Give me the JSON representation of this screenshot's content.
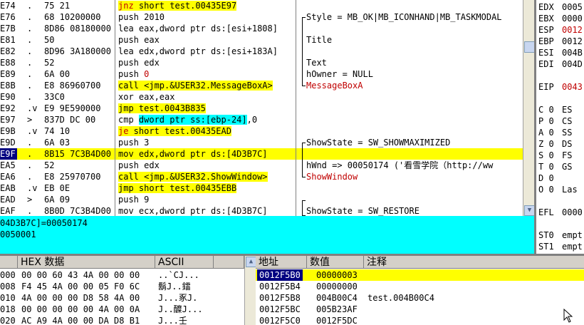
{
  "disasm": {
    "rows": [
      {
        "addr": "E74",
        "mark": ".",
        "op": "75 21",
        "instr": [
          {
            "t": "jnz",
            "c": "red hl-y"
          },
          {
            "t": " short test.00435E97",
            "c": "hl-y"
          }
        ],
        "comment": ""
      },
      {
        "addr": "E76",
        "mark": ".",
        "op": "68 10200000",
        "instr": [
          {
            "t": "push 2010",
            "c": ""
          }
        ],
        "comment": "Style = MB_OK|MB_ICONHAND|MB_TASKMODAL",
        "cm": "top"
      },
      {
        "addr": "E7B",
        "mark": ".",
        "op": "8D86 08180000",
        "instr": [
          {
            "t": "lea eax,dword ptr ds:[esi+1808]",
            "c": ""
          }
        ],
        "comment": ""
      },
      {
        "addr": "E81",
        "mark": ".",
        "op": "50",
        "instr": [
          {
            "t": "push eax",
            "c": ""
          }
        ],
        "comment": "Title",
        "cm": "mid"
      },
      {
        "addr": "E82",
        "mark": ".",
        "op": "8D96 3A180000",
        "instr": [
          {
            "t": "lea edx,dword ptr ds:[esi+183A]",
            "c": ""
          }
        ],
        "comment": ""
      },
      {
        "addr": "E88",
        "mark": ".",
        "op": "52",
        "instr": [
          {
            "t": "push edx",
            "c": ""
          }
        ],
        "comment": "Text",
        "cm": "mid"
      },
      {
        "addr": "E89",
        "mark": ".",
        "op": "6A 00",
        "instr": [
          {
            "t": "push ",
            "c": ""
          },
          {
            "t": "0",
            "c": "red"
          }
        ],
        "comment": "hOwner = NULL",
        "cm": "mid"
      },
      {
        "addr": "E8B",
        "mark": ".",
        "op": "E8 86960700",
        "instr": [
          {
            "t": "call",
            "c": "hl-y"
          },
          {
            "t": " <jmp.&USER32.MessageBoxA>",
            "c": "hl-y"
          }
        ],
        "comment": "MessageBoxA",
        "cm": "bot",
        "cred": true
      },
      {
        "addr": "E90",
        "mark": ".",
        "op": "33C0",
        "instr": [
          {
            "t": "xor eax,eax",
            "c": ""
          }
        ],
        "comment": ""
      },
      {
        "addr": "E92",
        "mark": ".v",
        "op": "E9 9E590000",
        "instr": [
          {
            "t": "jmp",
            "c": "hl-y"
          },
          {
            "t": " test.0043B835",
            "c": "hl-y"
          }
        ],
        "comment": ""
      },
      {
        "addr": "E97",
        "mark": ">",
        "op": "837D DC 00",
        "instr": [
          {
            "t": "cmp ",
            "c": ""
          },
          {
            "t": "dword ptr ss:[ebp-24]",
            "c": "hl-c"
          },
          {
            "t": ",0",
            "c": ""
          }
        ],
        "comment": ""
      },
      {
        "addr": "E9B",
        "mark": ".v",
        "op": "74 10",
        "instr": [
          {
            "t": "je",
            "c": "red hl-y"
          },
          {
            "t": " short test.00435EAD",
            "c": "hl-y"
          }
        ],
        "comment": ""
      },
      {
        "addr": "E9D",
        "mark": ".",
        "op": "6A 03",
        "instr": [
          {
            "t": "push 3",
            "c": ""
          }
        ],
        "comment": "ShowState = SW_SHOWMAXIMIZED",
        "cm": "top"
      },
      {
        "addr": "E9F",
        "mark": ".",
        "op": "8B15 7C3B4D00",
        "instr": [
          {
            "t": "mov edx,dword ptr ds:[4D3B7C]",
            "c": ""
          }
        ],
        "comment": "",
        "sel": true
      },
      {
        "addr": "EA5",
        "mark": ".",
        "op": "52",
        "instr": [
          {
            "t": "push edx",
            "c": ""
          }
        ],
        "comment": "hWnd => 00050174 ('看雪学院（http://ww",
        "cm": "mid"
      },
      {
        "addr": "EA6",
        "mark": ".",
        "op": "E8 25970700",
        "instr": [
          {
            "t": "call",
            "c": "hl-y"
          },
          {
            "t": " <jmp.&USER32.ShowWindow>",
            "c": "hl-y"
          }
        ],
        "comment": "ShowWindow",
        "cm": "bot",
        "cred": true
      },
      {
        "addr": "EAB",
        "mark": ".v",
        "op": "EB 0E",
        "instr": [
          {
            "t": "jmp",
            "c": "hl-y"
          },
          {
            "t": " short test.00435EBB",
            "c": "hl-y"
          }
        ],
        "comment": ""
      },
      {
        "addr": "EAD",
        "mark": ">",
        "op": "6A 09",
        "instr": [
          {
            "t": "push 9",
            "c": ""
          }
        ],
        "comment": ""
      },
      {
        "addr": "EAF",
        "mark": ".",
        "op": "8B0D 7C3B4D00",
        "instr": [
          {
            "t": "mov ecx,dword ptr ds:[4D3B7C]",
            "c": ""
          }
        ],
        "comment": "ShowState = SW_RESTORE",
        "cm": "top"
      }
    ]
  },
  "registers": {
    "rows": [
      {
        "name": "EDX",
        "val": "0005",
        "c": "blk"
      },
      {
        "name": "EBX",
        "val": "0000",
        "c": "blk"
      },
      {
        "name": "ESP",
        "val": "0012",
        "c": "red"
      },
      {
        "name": "EBP",
        "val": "0012",
        "c": "blk"
      },
      {
        "name": "ESI",
        "val": "004B",
        "c": "blk"
      },
      {
        "name": "EDI",
        "val": "004D",
        "c": "blk"
      },
      {
        "name": "",
        "val": "",
        "c": "blk"
      },
      {
        "name": "EIP",
        "val": "0043",
        "c": "red"
      },
      {
        "name": "",
        "val": "",
        "c": "blk"
      },
      {
        "name": "C 0",
        "val": "ES",
        "c": "blk"
      },
      {
        "name": "P 0",
        "val": "CS",
        "c": "blk"
      },
      {
        "name": "A 0",
        "val": "SS",
        "c": "blk"
      },
      {
        "name": "Z 0",
        "val": "DS",
        "c": "blk"
      },
      {
        "name": "S 0",
        "val": "FS",
        "c": "blk"
      },
      {
        "name": "T 0",
        "val": "GS",
        "c": "blk"
      },
      {
        "name": "D 0",
        "val": "",
        "c": "blk"
      },
      {
        "name": "O 0",
        "val": "Las",
        "c": "blk"
      },
      {
        "name": "",
        "val": "",
        "c": "blk"
      },
      {
        "name": "EFL",
        "val": "0000",
        "c": "blk"
      },
      {
        "name": "",
        "val": "",
        "c": "blk"
      },
      {
        "name": "ST0",
        "val": "empt",
        "c": "blk"
      },
      {
        "name": "ST1",
        "val": "empt",
        "c": "blk"
      },
      {
        "name": "ST2",
        "val": "empt",
        "c": "blk"
      },
      {
        "name": "ST3",
        "val": "empt",
        "c": "blk"
      }
    ]
  },
  "info": {
    "line1": "04D3B7C]=00050174",
    "line2": "0050001"
  },
  "dump": {
    "headers": {
      "hex": "HEX 数据",
      "ascii": "ASCII"
    },
    "rows": [
      {
        "addr": "000",
        "hex": "00 00 60 43 4A 00 00 00",
        "ascii": "..`CJ..."
      },
      {
        "addr": "008",
        "hex": "F4 45 4A 00 00 05 F0 6C",
        "ascii": "鬍J..鐳"
      },
      {
        "addr": "010",
        "hex": "4A 00 00 00 D8 58 4A 00",
        "ascii": "J...豖J."
      },
      {
        "addr": "018",
        "hex": "00 00 00 00 00 4A 00 0A",
        "ascii": "J..醾J..."
      },
      {
        "addr": "020",
        "hex": "AC A9 4A 00 00 DA D8 B1",
        "ascii": "J...壬"
      }
    ]
  },
  "stack": {
    "headers": {
      "addr": "地址",
      "value": "数值",
      "comment": "注释"
    },
    "rows": [
      {
        "addr": "0012F5B0",
        "value": "00000003",
        "comment": "",
        "sel": true
      },
      {
        "addr": "0012F5B4",
        "value": "00000000",
        "comment": ""
      },
      {
        "addr": "0012F5B8",
        "value": "004B00C4",
        "comment": "test.004B00C4"
      },
      {
        "addr": "0012F5BC",
        "value": "005B23AF",
        "comment": ""
      },
      {
        "addr": "0012F5C0",
        "value": "0012F5DC",
        "comment": ""
      }
    ]
  }
}
